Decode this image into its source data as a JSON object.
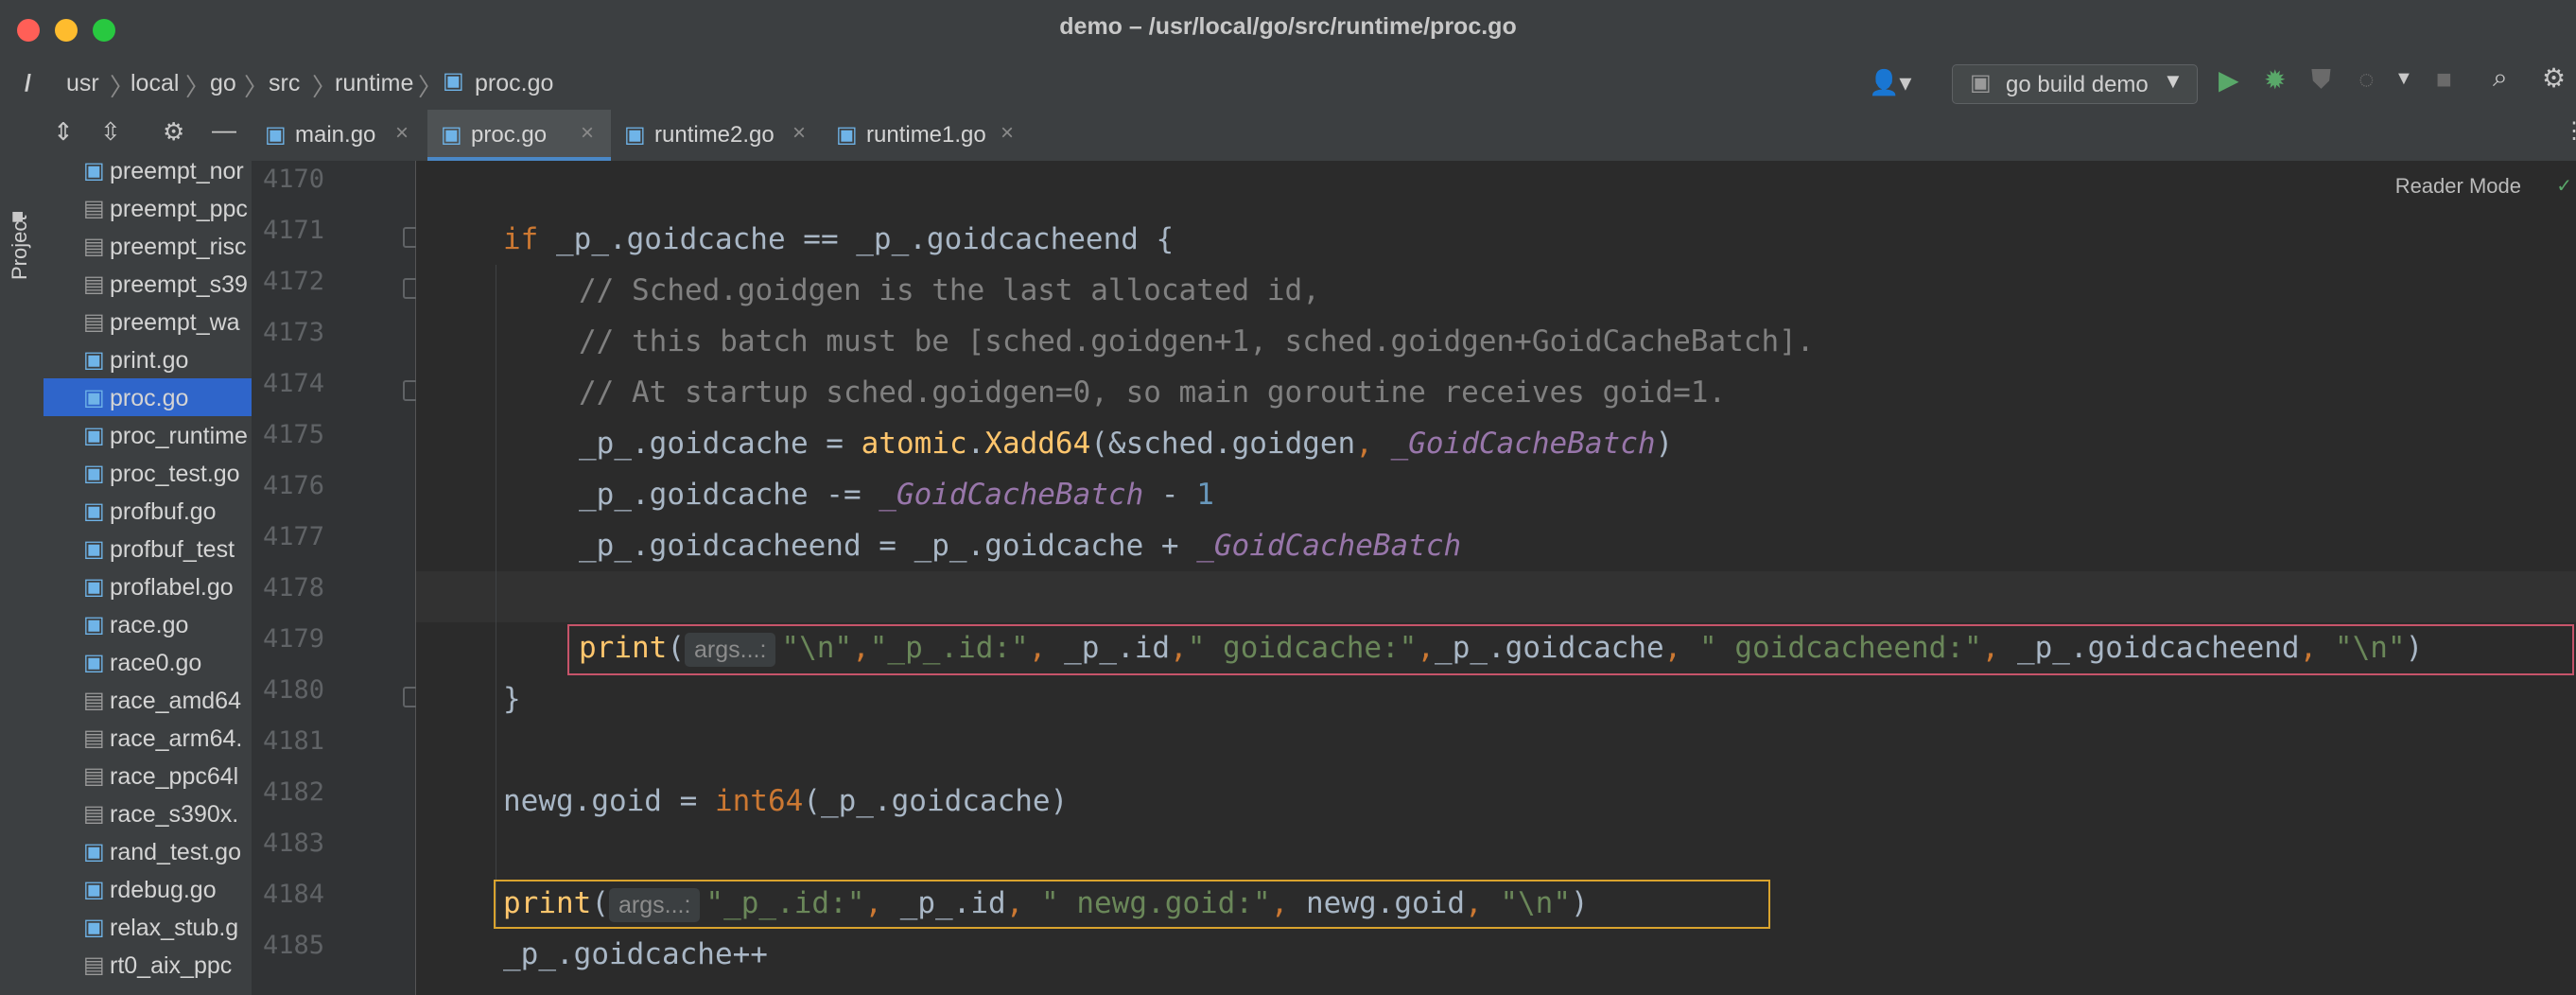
{
  "window": {
    "title": "demo – /usr/local/go/src/runtime/proc.go"
  },
  "navbar": {
    "breadcrumbs": [
      "/",
      "usr",
      "local",
      "go",
      "src",
      "runtime",
      "proc.go"
    ],
    "run_config": "go build demo"
  },
  "sidebar": {
    "tool_window_label": "Project",
    "items": [
      {
        "label": "preempt_nor",
        "icon": "gopher-icon"
      },
      {
        "label": "preempt_ppc",
        "icon": "chip-icon"
      },
      {
        "label": "preempt_risc",
        "icon": "chip-icon"
      },
      {
        "label": "preempt_s39",
        "icon": "chip-icon"
      },
      {
        "label": "preempt_wa",
        "icon": "chip-icon"
      },
      {
        "label": "print.go",
        "icon": "gopher-icon"
      },
      {
        "label": "proc.go",
        "icon": "gopher-icon",
        "selected": true
      },
      {
        "label": "proc_runtime",
        "icon": "gopher-icon"
      },
      {
        "label": "proc_test.go",
        "icon": "gopher-icon"
      },
      {
        "label": "profbuf.go",
        "icon": "gopher-icon"
      },
      {
        "label": "profbuf_test",
        "icon": "gopher-icon"
      },
      {
        "label": "proflabel.go",
        "icon": "gopher-icon"
      },
      {
        "label": "race.go",
        "icon": "gopher-icon"
      },
      {
        "label": "race0.go",
        "icon": "gopher-icon"
      },
      {
        "label": "race_amd64",
        "icon": "chip-icon"
      },
      {
        "label": "race_arm64.",
        "icon": "chip-icon"
      },
      {
        "label": "race_ppc64l",
        "icon": "chip-icon"
      },
      {
        "label": "race_s390x.",
        "icon": "chip-icon"
      },
      {
        "label": "rand_test.go",
        "icon": "gopher-icon"
      },
      {
        "label": "rdebug.go",
        "icon": "gopher-icon"
      },
      {
        "label": "relax_stub.g",
        "icon": "gopher-icon"
      },
      {
        "label": "rt0_aix_ppc",
        "icon": "chip-icon"
      }
    ]
  },
  "tabs": [
    {
      "label": "main.go",
      "active": false
    },
    {
      "label": "proc.go",
      "active": true
    },
    {
      "label": "runtime2.go",
      "active": false
    },
    {
      "label": "runtime1.go",
      "active": false
    }
  ],
  "editor": {
    "reader_mode": "Reader Mode",
    "hint_label": "args...:",
    "line_numbers": [
      "4170",
      "4171",
      "4172",
      "4173",
      "4174",
      "4175",
      "4176",
      "4177",
      "4178",
      "4179",
      "4180",
      "4181",
      "4182",
      "4183",
      "4184",
      "4185"
    ],
    "lines": {
      "l4171_kw": "if",
      "l4171_rest": " _p_.goidcache == _p_.goidcacheend {",
      "l4172": "// Sched.goidgen is the last allocated id,",
      "l4173": "// this batch must be [sched.goidgen+1, sched.goidgen+GoidCacheBatch].",
      "l4174": "// At startup sched.goidgen=0, so main goroutine receives goid=1.",
      "l4175_a": "_p_.goidcache = ",
      "l4175_fn": "atomic",
      "l4175_b": ".",
      "l4175_fn2": "Xadd64",
      "l4175_c": "(&sched.goidgen",
      "l4175_comma": ", ",
      "l4175_const": "_GoidCacheBatch",
      "l4175_d": ")",
      "l4176_a": "_p_.goidcache -= ",
      "l4176_const": "_GoidCacheBatch",
      "l4176_b": " - ",
      "l4176_num": "1",
      "l4177_a": "_p_.goidcacheend = _p_.goidcache + ",
      "l4177_const": "_GoidCacheBatch",
      "l4179_fn": "print",
      "l4179_open": "(",
      "l4179_s1": "\"\\n\"",
      "l4179_c1": ",",
      "l4179_s2": "\"_p_.id:\"",
      "l4179_c2": ", ",
      "l4179_v1": "_p_.id",
      "l4179_c3": ",",
      "l4179_s3": "\" goidcache:\"",
      "l4179_c4": ",",
      "l4179_v2": "_p_.goidcache",
      "l4179_c5": ", ",
      "l4179_s4": "\" goidcacheend:\"",
      "l4179_c6": ", ",
      "l4179_v3": "_p_.goidcacheend",
      "l4179_c7": ", ",
      "l4179_s5": "\"\\n\"",
      "l4179_close": ")",
      "l4180": "}",
      "l4182_a": "newg.goid = ",
      "l4182_ty": "int64",
      "l4182_b": "(_p_.goidcache)",
      "l4184_fn": "print",
      "l4184_open": "(",
      "l4184_s1": "\"_p_.id:\"",
      "l4184_c1": ", ",
      "l4184_v1": "_p_.id",
      "l4184_c2": ", ",
      "l4184_s2": "\" newg.goid:\"",
      "l4184_c3": ", ",
      "l4184_v2": "newg.goid",
      "l4184_c4": ", ",
      "l4184_s3": "\"\\n\"",
      "l4184_close": ")",
      "l4185": "_p_.goidcache++"
    }
  },
  "colors": {
    "highlight_box_1": "#c7546a",
    "highlight_box_2": "#d9a32e",
    "selection": "#2f65ca"
  }
}
